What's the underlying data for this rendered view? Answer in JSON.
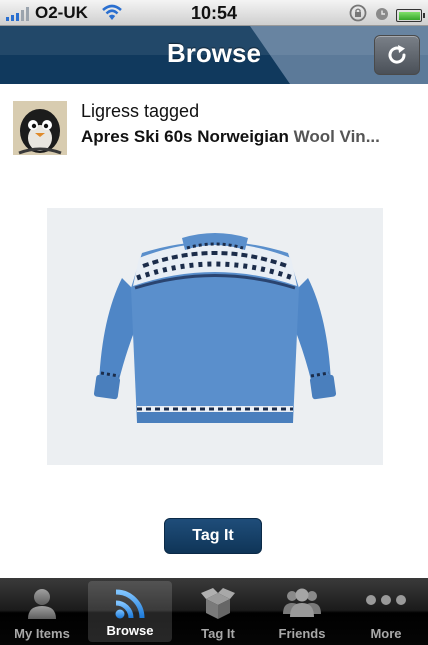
{
  "status_bar": {
    "carrier": "O2-UK",
    "time": "10:54"
  },
  "nav": {
    "title": "Browse",
    "refresh_icon": "refresh-icon"
  },
  "post": {
    "user_action": "Ligress tagged",
    "item_title_main": "Apres Ski 60s Norweigian",
    "item_title_rest": " Wool Vin..."
  },
  "actions": {
    "tag_button_label": "Tag It"
  },
  "tab_bar": {
    "tabs": [
      {
        "label": "My Items",
        "icon": "person-icon"
      },
      {
        "label": "Browse",
        "icon": "broadcast-icon"
      },
      {
        "label": "Tag It",
        "icon": "box-icon"
      },
      {
        "label": "Friends",
        "icon": "people-icon"
      },
      {
        "label": "More",
        "icon": "more-icon"
      }
    ],
    "selected": "Browse"
  },
  "colors": {
    "nav_bar": "#123e64",
    "tag_button": "#173f66",
    "sweater": "#4f86c6"
  }
}
